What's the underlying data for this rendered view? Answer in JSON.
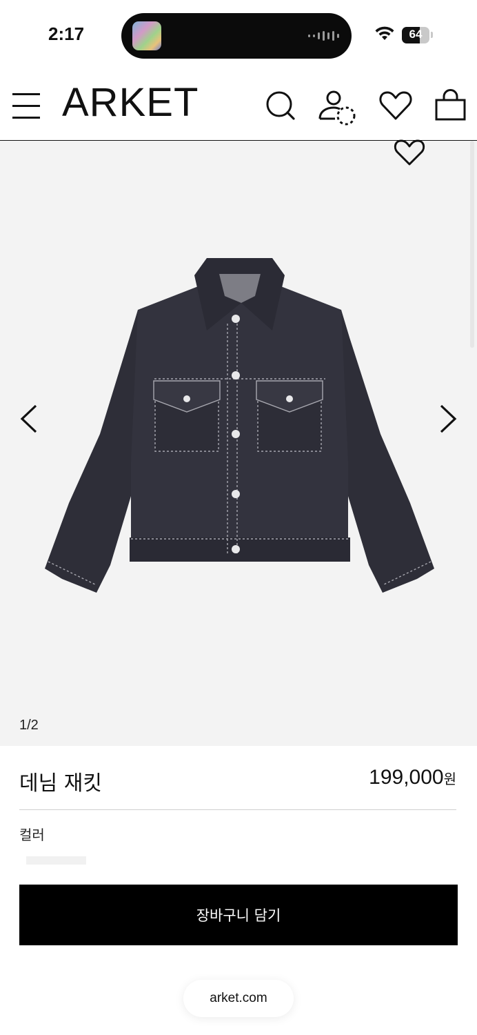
{
  "status_bar": {
    "time": "2:17",
    "battery_percent": "64",
    "battery_level": 0.64
  },
  "header": {
    "logo": "ARKET",
    "icons": [
      "menu-icon",
      "search-icon",
      "account-icon",
      "wishlist-icon",
      "bag-icon"
    ]
  },
  "gallery": {
    "counter": "1/2",
    "background_color": "#f3f3f3",
    "icons": [
      "wishlist-heart-icon",
      "chevron-left-icon",
      "chevron-right-icon"
    ]
  },
  "product": {
    "name": "데님 재킷",
    "price": "199,000",
    "price_unit": "원",
    "color_label": "컬러"
  },
  "cart": {
    "button_label": "장바구니 담기"
  },
  "browser": {
    "url": "arket.com"
  },
  "colors": {
    "accent": "#000000",
    "denim": "#2f2f3a"
  }
}
